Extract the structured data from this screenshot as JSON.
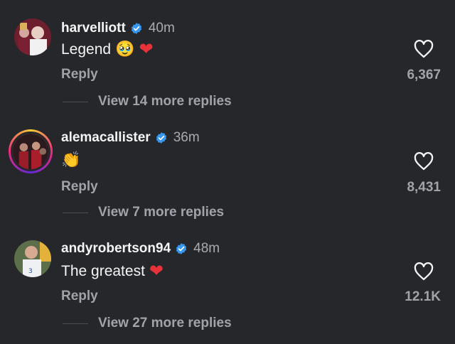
{
  "comments": [
    {
      "username": "harvelliott",
      "time": "40m",
      "text": "Legend",
      "emojis": [
        "🥹",
        "❤"
      ],
      "reply_label": "Reply",
      "likes": "6,367",
      "view_replies": "View 14 more replies",
      "avatar_colors": [
        "#6d1f2d",
        "#d9c3c0"
      ]
    },
    {
      "username": "alemacallister",
      "time": "36m",
      "text": "",
      "emojis": [
        "👏"
      ],
      "reply_label": "Reply",
      "likes": "8,431",
      "view_replies": "View 7 more replies",
      "avatar_colors": [
        "#8a1c24",
        "#2a1a1e"
      ]
    },
    {
      "username": "andyrobertson94",
      "time": "48m",
      "text": "The greatest",
      "emojis": [
        "❤"
      ],
      "reply_label": "Reply",
      "likes": "12.1K",
      "view_replies": "View 27 more replies",
      "avatar_colors": [
        "#e4e6ea",
        "#2f6b3a"
      ]
    }
  ],
  "colors": {
    "background": "#25272b",
    "verified": "#3897f0",
    "heart": "#e8323a",
    "muted": "#a0a4aa"
  }
}
